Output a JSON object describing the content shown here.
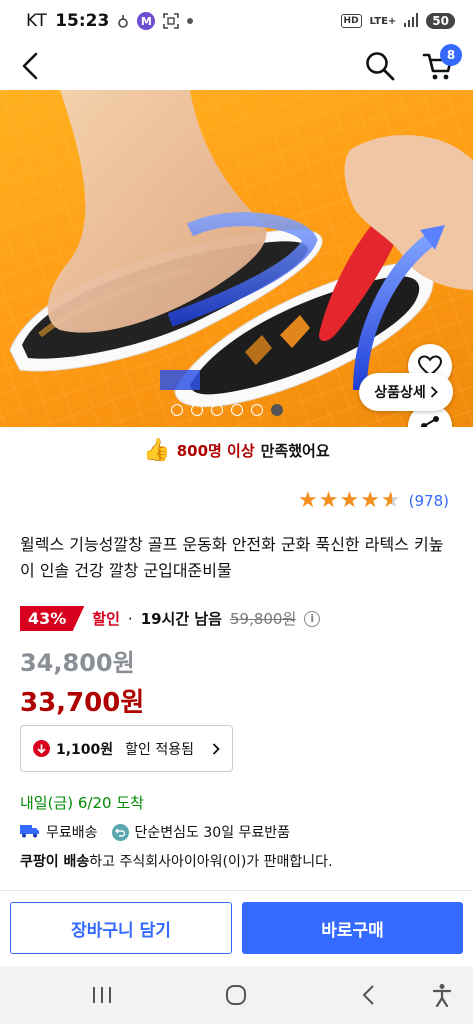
{
  "status_bar": {
    "carrier": "KT",
    "time": "15:23",
    "m_icon_letter": "M",
    "network": "LTE+",
    "hd": "HD",
    "battery": "50"
  },
  "header": {
    "cart_count": "8"
  },
  "hero": {
    "detail_button_label": "상품상세",
    "slide_count": 6,
    "active_slide": 6
  },
  "satisfaction": {
    "count_text": "800명 이상",
    "rest_text": "만족했어요"
  },
  "rating": {
    "stars": 4.5,
    "review_count": "(978)"
  },
  "product": {
    "title": "윌렉스 기능성깔창 골프 운동화 안전화 군화 푹신한 라텍스 키높이 인솔 건강 깔창 군입대준비물"
  },
  "price": {
    "discount_percent": "43%",
    "discount_label": "할인",
    "separator": "·",
    "time_left": "19시간 남음",
    "original_price": "59,800원",
    "info_icon": "i",
    "sale_price": "34,800원",
    "final_price": "33,700원"
  },
  "coupon": {
    "amount": "1,100원",
    "label": "할인 적용됨"
  },
  "delivery": {
    "arrival": "내일(금) 6/20 도착",
    "free_shipping": "무료배송",
    "free_return": "단순변심도 30일 무료반품",
    "seller_bold": "쿠팡이 배송",
    "seller_rest": "하고 주식회사아이아워(이)가 판매합니다."
  },
  "actions": {
    "add_to_cart": "장바구니 담기",
    "buy_now": "바로구매"
  },
  "colors": {
    "accent": "#346aff",
    "discount_red": "#d8001c",
    "price_red": "#ae0000",
    "arrival_green": "#008c00",
    "star": "#f28f1e",
    "hero_bg": "#ff9a14"
  }
}
